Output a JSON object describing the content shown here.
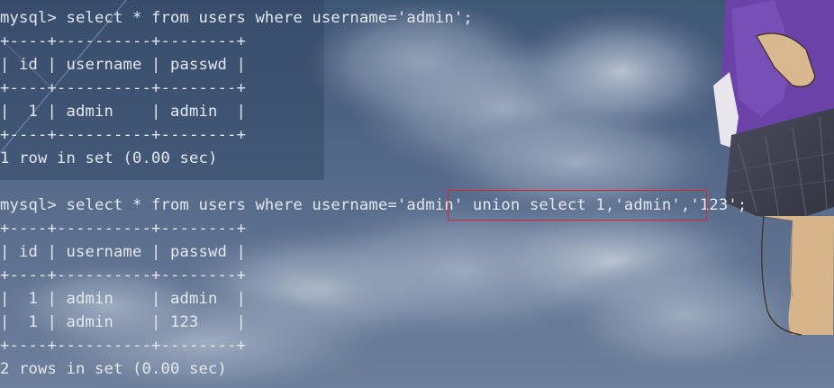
{
  "terminal": {
    "lines": [
      "mysql> select * from users where username='admin';",
      "+----+----------+--------+",
      "| id | username | passwd |",
      "+----+----------+--------+",
      "|  1 | admin    | admin  |",
      "+----+----------+--------+",
      "1 row in set (0.00 sec)",
      "",
      "mysql> select * from users where username='admin' union select 1,'admin','123';",
      "+----+----------+--------+",
      "| id | username | passwd |",
      "+----+----------+--------+",
      "|  1 | admin    | admin  |",
      "|  1 | admin    | 123    |",
      "+----+----------+--------+",
      "2 rows in set (0.00 sec)"
    ]
  },
  "colors": {
    "highlight_border": "#d6262d",
    "text": "#e4e8ee"
  }
}
